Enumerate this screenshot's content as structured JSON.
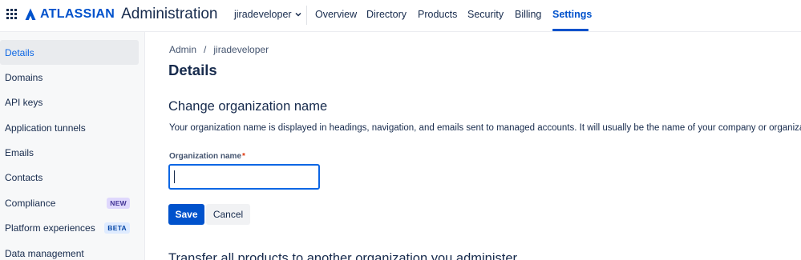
{
  "header": {
    "brand": "ATLASSIAN",
    "product": "Administration",
    "org_name": "jiradeveloper",
    "tabs": [
      {
        "label": "Overview"
      },
      {
        "label": "Directory"
      },
      {
        "label": "Products"
      },
      {
        "label": "Security"
      },
      {
        "label": "Billing"
      },
      {
        "label": "Settings",
        "active": true
      }
    ]
  },
  "sidebar": {
    "items": [
      {
        "label": "Details",
        "active": true
      },
      {
        "label": "Domains"
      },
      {
        "label": "API keys"
      },
      {
        "label": "Application tunnels"
      },
      {
        "label": "Emails"
      },
      {
        "label": "Contacts"
      },
      {
        "label": "Compliance",
        "badge": "NEW"
      },
      {
        "label": "Platform experiences",
        "badge": "BETA"
      },
      {
        "label": "Data management"
      }
    ]
  },
  "breadcrumb": {
    "items": [
      "Admin",
      "jiradeveloper"
    ],
    "separator": "/"
  },
  "main": {
    "page_title": "Details",
    "section_title": "Change organization name",
    "section_description": "Your organization name is displayed in headings, navigation, and emails sent to managed accounts. It will usually be the name of your company or organizat",
    "field_label": "Organization name",
    "required_marker": "*",
    "field_value": "",
    "save_label": "Save",
    "cancel_label": "Cancel",
    "next_section_title": "Transfer all products to another organization you administer"
  },
  "colors": {
    "brand_blue": "#0052cc",
    "focus_blue": "#0c66e4",
    "text": "#172b4d",
    "sidebar_bg": "#f7f8f9"
  }
}
